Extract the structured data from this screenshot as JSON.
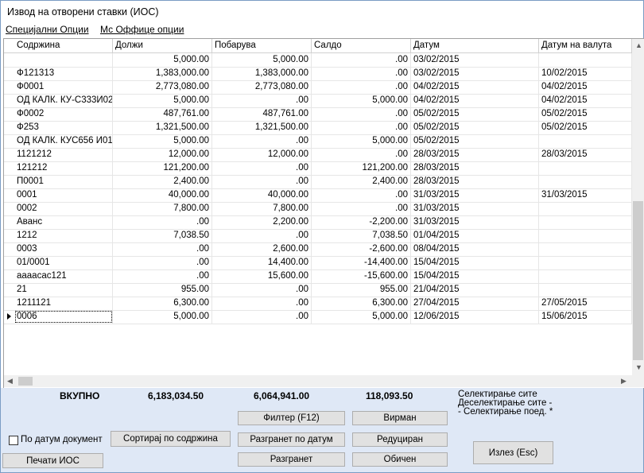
{
  "window": {
    "title": "Извод на отворени ставки (ИОС)"
  },
  "menu": {
    "items": [
      "Специјални Опции",
      "Мс Оффице опции"
    ]
  },
  "grid": {
    "columns": [
      "Содржина",
      "Должи",
      "Побарува",
      "Салдо",
      "Датум",
      "Датум на валута"
    ],
    "rows": [
      [
        "",
        "5,000.00",
        "5,000.00",
        ".00",
        "03/02/2015",
        ""
      ],
      [
        "Ф121313",
        "1,383,000.00",
        "1,383,000.00",
        ".00",
        "03/02/2015",
        "10/02/2015"
      ],
      [
        "Ф0001",
        "2,773,080.00",
        "2,773,080.00",
        ".00",
        "04/02/2015",
        "04/02/2015"
      ],
      [
        "ОД КАЛК. КУ-С333И02",
        "5,000.00",
        ".00",
        "5,000.00",
        "04/02/2015",
        "04/02/2015"
      ],
      [
        "Ф0002",
        "487,761.00",
        "487,761.00",
        ".00",
        "05/02/2015",
        "05/02/2015"
      ],
      [
        "Ф253",
        "1,321,500.00",
        "1,321,500.00",
        ".00",
        "05/02/2015",
        "05/02/2015"
      ],
      [
        "ОД КАЛК. КУС656 И01",
        "5,000.00",
        ".00",
        "5,000.00",
        "05/02/2015",
        ""
      ],
      [
        "1121212",
        "12,000.00",
        "12,000.00",
        ".00",
        "28/03/2015",
        "28/03/2015"
      ],
      [
        "121212",
        "121,200.00",
        ".00",
        "121,200.00",
        "28/03/2015",
        ""
      ],
      [
        "П0001",
        "2,400.00",
        ".00",
        "2,400.00",
        "28/03/2015",
        ""
      ],
      [
        "0001",
        "40,000.00",
        "40,000.00",
        ".00",
        "31/03/2015",
        "31/03/2015"
      ],
      [
        "0002",
        "7,800.00",
        "7,800.00",
        ".00",
        "31/03/2015",
        ""
      ],
      [
        "Аванс",
        ".00",
        "2,200.00",
        "-2,200.00",
        "31/03/2015",
        ""
      ],
      [
        "1212",
        "7,038.50",
        ".00",
        "7,038.50",
        "01/04/2015",
        ""
      ],
      [
        "0003",
        ".00",
        "2,600.00",
        "-2,600.00",
        "08/04/2015",
        ""
      ],
      [
        "01/0001",
        ".00",
        "14,400.00",
        "-14,400.00",
        "15/04/2015",
        ""
      ],
      [
        "аааасас121",
        ".00",
        "15,600.00",
        "-15,600.00",
        "15/04/2015",
        ""
      ],
      [
        "21",
        "955.00",
        ".00",
        "955.00",
        "21/04/2015",
        ""
      ],
      [
        "1211121",
        "6,300.00",
        ".00",
        "6,300.00",
        "27/04/2015",
        "27/05/2015"
      ],
      [
        "0006",
        "5,000.00",
        ".00",
        "5,000.00",
        "12/06/2015",
        "15/06/2015"
      ]
    ],
    "current_row": 19
  },
  "totals": {
    "label": "ВКУПНО",
    "dolzi": "6,183,034.50",
    "pobaruva": "6,064,941.00",
    "saldo": "118,093.50"
  },
  "selection_links": [
    "Селектирање сите",
    "Деселектирање сите -",
    "- Селектирање поед. *"
  ],
  "buttons": {
    "filter": "Филтер (F12)",
    "virman": "Вирман",
    "sort": "Сортирај по содржина",
    "group_by_date": "Разгранет по датум",
    "reduced": "Редуциран",
    "grouped": "Разгранет",
    "plain": "Обичен",
    "exit": "Излез (Esc)",
    "print": "Печати ИОС"
  },
  "checkbox": {
    "label": "По датум документ",
    "checked": false
  }
}
